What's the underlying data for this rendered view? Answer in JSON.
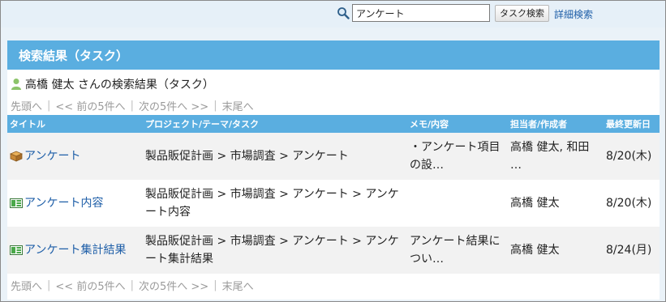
{
  "search": {
    "value": "アンケート",
    "button_label": "タスク検索",
    "advanced_link": "詳細検索"
  },
  "panel": {
    "title": "検索結果（タスク）",
    "user_line": "高橋 健太 さんの検索結果（タスク）"
  },
  "pager": {
    "first": "先頭へ",
    "prev": "<< 前の5件へ",
    "next": "次の5件へ >>",
    "last": "末尾へ",
    "separator": "|"
  },
  "table": {
    "headers": {
      "title": "タイトル",
      "project": "プロジェクト/テーマ/タスク",
      "memo": "メモ/内容",
      "owner": "担当者/作成者",
      "updated": "最終更新日"
    },
    "rows": [
      {
        "icon": "box-icon",
        "title": "アンケート",
        "project": "製品販促計画 > 市場調査 > アンケート",
        "memo": "・アンケート項目の設…",
        "owner": "高橋 健太, 和田 …",
        "updated": "8/20(木)"
      },
      {
        "icon": "task-list-icon",
        "title": "アンケート内容",
        "project": "製品販促計画 > 市場調査 > アンケート > アンケート内容",
        "memo": "",
        "owner": "高橋 健太",
        "updated": "8/20(木)"
      },
      {
        "icon": "task-list-icon",
        "title": "アンケート集計結果",
        "project": "製品販促計画 > 市場調査 > アンケート > アンケート集計結果",
        "memo": "アンケート結果につい…",
        "owner": "高橋 健太",
        "updated": "8/24(月)"
      }
    ]
  },
  "colors": {
    "header_blue": "#5aaee0",
    "link_blue": "#1f5fa8",
    "pager_gray": "#9a9a9a"
  }
}
